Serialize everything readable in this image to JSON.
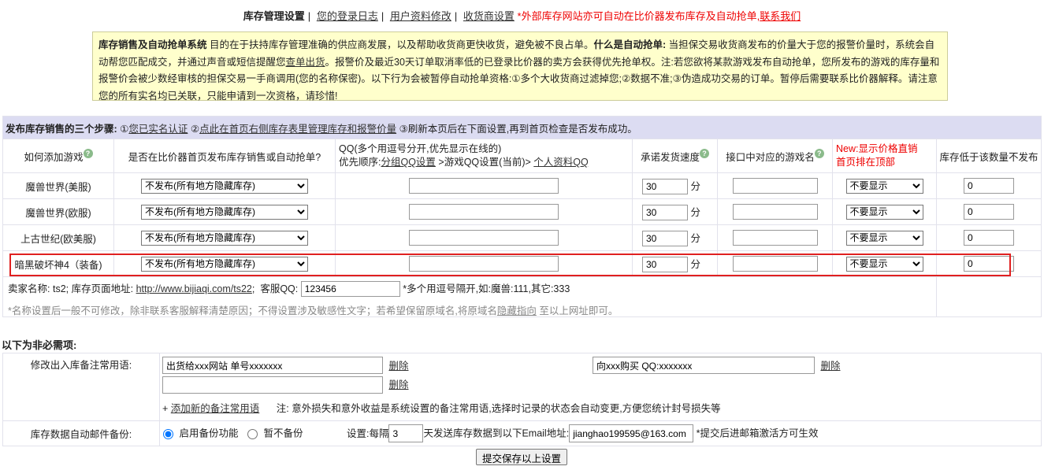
{
  "nav": {
    "current": "库存管理设置",
    "link1": "您的登录日志",
    "link2": "用户资料修改",
    "link3": "收货商设置",
    "notice_red": "*外部库存网站亦可自动在比价器发布库存及自动抢单,",
    "contact": "联系我们"
  },
  "notice": {
    "title": "库存销售及自动抢单系统",
    "text1": " 目的在于扶持库存管理准确的供应商发展，以及帮助收货商更快收货，避免被不良占单。",
    "bold2": "什么是自动抢单:",
    "text2": " 当担保交易收货商发布的价量大于您的报警价量时，系统会自动帮您匹配成交，并通过声音或短信提醒您",
    "link": "查单出货",
    "text3": "。报警价及最近30天订单取消率低的已登录比价器的卖方会获得优先抢单权。注:若您欲将某款游戏发布自动抢单，您所发布的游戏的库存量和报警价会被少数经审核的担保交易一手商调用(您的名称保密)。以下行为会被暂停自动抢单资格:①多个大收货商过滤掉您;②数据不准;③伪造成功交易的订单。暂停后需要联系比价器解释。请注意您的所有实名均已关联，只能申请到一次资格，请珍惜!"
  },
  "steps": {
    "title": "发布库存销售的三个步骤:",
    "s1_num": "①",
    "s1": "您已实名认证",
    "s2_num": "②",
    "s2": "点此在首页右侧库存表里管理库存和报警价量",
    "s3": "③刷新本页后在下面设置,再到首页检查是否发布成功。"
  },
  "headers": {
    "c1": "如何添加游戏",
    "c2": "是否在比价器首页发布库存销售或自动抢单?",
    "c3_line1": "QQ(多个用逗号分开,优先显示在线的)",
    "c3_prefix": "优先顺序:",
    "c3_link1": "分组QQ设置",
    "c3_mid": " >游戏QQ设置(当前)> ",
    "c3_link2": "个人资料QQ",
    "c4": "承诺发货速度",
    "c5": "接口中对应的游戏名",
    "c6_line1": "New:显示价格直销",
    "c6_line2": "首页排在顶部",
    "c7": "库存低于该数量不发布",
    "help": "?"
  },
  "rows": [
    {
      "game": "魔兽世界(美服)",
      "publish": "不发布(所有地方隐藏库存)",
      "qq": "",
      "speed": "30",
      "unit": "分",
      "api_name": "",
      "display": "不要显示",
      "min_stock": "0"
    },
    {
      "game": "魔兽世界(欧服)",
      "publish": "不发布(所有地方隐藏库存)",
      "qq": "",
      "speed": "30",
      "unit": "分",
      "api_name": "",
      "display": "不要显示",
      "min_stock": "0"
    },
    {
      "game": "上古世纪(欧美服)",
      "publish": "不发布(所有地方隐藏库存)",
      "qq": "",
      "speed": "30",
      "unit": "分",
      "api_name": "",
      "display": "不要显示",
      "min_stock": "0"
    },
    {
      "game": "暗黑破坏神4（装备)",
      "publish": "不发布(所有地方隐藏库存)",
      "qq": "",
      "speed": "30",
      "unit": "分",
      "api_name": "",
      "display": "不要显示",
      "min_stock": "0"
    }
  ],
  "seller": {
    "label": "卖家名称:",
    "name": "ts2;",
    "url_label": "库存页面地址:",
    "url": "http://www.bijiaqi.com/ts22",
    "semicolon": ";",
    "qq_label": "客服QQ:",
    "qq_value": "123456",
    "qq_hint": "*多个用逗号隔开,如:魔兽:111,其它:333",
    "note_prefix": "*名称设置后一般不可修改，除非联系客服解释清楚原因；不得设置涉及敏感性文字；若希望保留原域名,将原域名",
    "note_link": "隐藏指向",
    "note_suffix": "至以上网址即可。"
  },
  "optional": {
    "title": "以下为非必需项:",
    "remarks_label": "修改出入库备注常用语:",
    "remark1": "出货给xxx网站 单号xxxxxxx",
    "remark2": "向xxx购买 QQ:xxxxxxx",
    "remark3": "",
    "delete": "删除",
    "add_prefix": "+ ",
    "add_link": "添加新的备注常用语",
    "add_note": "注: 意外损失和意外收益是系统设置的备注常用语,选择时记录的状态会自动变更,方便您统计封号损失等",
    "backup_label": "库存数据自动邮件备份:",
    "enable": "启用备份功能",
    "disable": "暂不备份",
    "every_prefix": "设置:每隔",
    "every_value": "3",
    "every_suffix": "天发送库存数据到以下Email地址:",
    "email": "jianghao199595@163.com",
    "email_note": "*提交后进邮箱激活方可生效"
  },
  "submit_label": "提交保存以上设置"
}
